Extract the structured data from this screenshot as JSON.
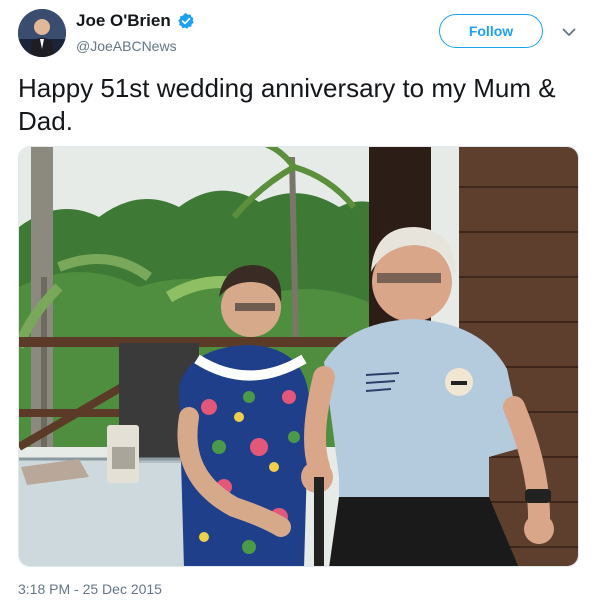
{
  "author": {
    "display_name": "Joe O'Brien",
    "handle": "@JoeABCNews",
    "verified": true
  },
  "actions": {
    "follow_label": "Follow"
  },
  "tweet": {
    "text": "Happy 51st wedding anniversary to my Mum & Dad.",
    "timestamp": "3:18 PM - 25 Dec 2015"
  },
  "icons": {
    "verified": "verified-badge-icon",
    "menu": "chevron-down-icon"
  },
  "colors": {
    "accent": "#1da1f2",
    "text_primary": "#14171a",
    "text_secondary": "#657786"
  }
}
